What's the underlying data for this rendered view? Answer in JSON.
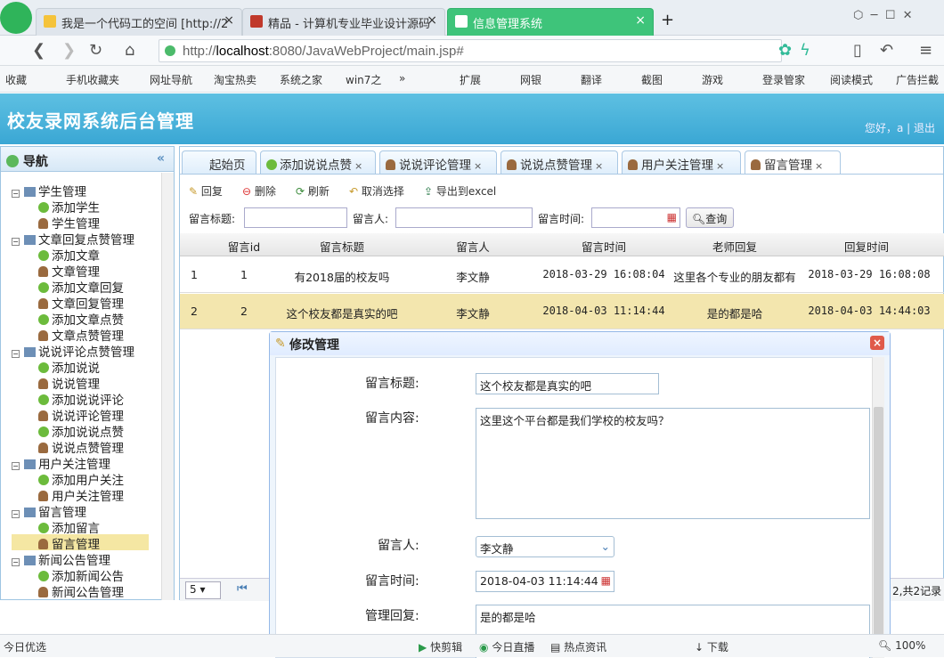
{
  "browser": {
    "tabs": [
      {
        "label": "我是一个代码工的空间 [http://2",
        "close": "×"
      },
      {
        "label": "精品 - 计算机专业毕业设计源码",
        "close": "×"
      },
      {
        "label": "信息管理系统",
        "close": "×"
      }
    ],
    "new_tab": "+",
    "url_prefix": "http://",
    "url_host": "localhost",
    "url_rest": ":8080/JavaWebProject/main.jsp#",
    "bookmarks": [
      "收藏",
      "手机收藏夹",
      "网址导航",
      "淘宝热卖",
      "系统之家",
      "win7之",
      "»",
      "扩展",
      "网银",
      "翻译",
      "截图",
      "游戏",
      "登录管家",
      "阅读模式",
      "广告拦截"
    ]
  },
  "app": {
    "title": "校友录网系统后台管理",
    "greeting": "您好，a",
    "logout": "退出"
  },
  "sidebar": {
    "title": "导航",
    "collapse": "«",
    "items": [
      {
        "label": "学生管理",
        "level": 0
      },
      {
        "label": "添加学生",
        "level": 1,
        "icon": "plus"
      },
      {
        "label": "学生管理",
        "level": 1,
        "icon": "user"
      },
      {
        "label": "文章回复点赞管理",
        "level": 0
      },
      {
        "label": "添加文章",
        "level": 1,
        "icon": "plus"
      },
      {
        "label": "文章管理",
        "level": 1,
        "icon": "user"
      },
      {
        "label": "添加文章回复",
        "level": 1,
        "icon": "plus"
      },
      {
        "label": "文章回复管理",
        "level": 1,
        "icon": "user"
      },
      {
        "label": "添加文章点赞",
        "level": 1,
        "icon": "plus"
      },
      {
        "label": "文章点赞管理",
        "level": 1,
        "icon": "user"
      },
      {
        "label": "说说评论点赞管理",
        "level": 0
      },
      {
        "label": "添加说说",
        "level": 1,
        "icon": "plus"
      },
      {
        "label": "说说管理",
        "level": 1,
        "icon": "user"
      },
      {
        "label": "添加说说评论",
        "level": 1,
        "icon": "plus"
      },
      {
        "label": "说说评论管理",
        "level": 1,
        "icon": "user"
      },
      {
        "label": "添加说说点赞",
        "level": 1,
        "icon": "plus"
      },
      {
        "label": "说说点赞管理",
        "level": 1,
        "icon": "user"
      },
      {
        "label": "用户关注管理",
        "level": 0
      },
      {
        "label": "添加用户关注",
        "level": 1,
        "icon": "plus"
      },
      {
        "label": "用户关注管理",
        "level": 1,
        "icon": "user"
      },
      {
        "label": "留言管理",
        "level": 0
      },
      {
        "label": "添加留言",
        "level": 1,
        "icon": "plus"
      },
      {
        "label": "留言管理",
        "level": 1,
        "icon": "user",
        "selected": true
      },
      {
        "label": "新闻公告管理",
        "level": 0
      },
      {
        "label": "添加新闻公告",
        "level": 1,
        "icon": "plus"
      },
      {
        "label": "新闻公告管理",
        "level": 1,
        "icon": "user"
      }
    ]
  },
  "page_tabs": [
    {
      "label": "起始页"
    },
    {
      "label": "添加说说点赞",
      "close": "×"
    },
    {
      "label": "说说评论管理",
      "close": "×"
    },
    {
      "label": "说说点赞管理",
      "close": "×"
    },
    {
      "label": "用户关注管理",
      "close": "×"
    },
    {
      "label": "留言管理",
      "close": "×",
      "active": true
    }
  ],
  "toolbar": {
    "reply": "回复",
    "delete": "删除",
    "refresh": "刷新",
    "cancel_select": "取消选择",
    "export": "导出到excel"
  },
  "search": {
    "title_label": "留言标题:",
    "person_label": "留言人:",
    "time_label": "留言时间:",
    "query": "查询"
  },
  "grid": {
    "columns": [
      "留言id",
      "留言标题",
      "留言人",
      "留言时间",
      "老师回复",
      "回复时间"
    ],
    "rows": [
      {
        "rownum": "1",
        "id": "1",
        "title": "有2018届的校友吗",
        "person": "李文静",
        "time": "2018-03-29 16:08:04",
        "reply": "这里各个专业的朋友都有",
        "reply_time": "2018-03-29 16:08:08"
      },
      {
        "rownum": "2",
        "id": "2",
        "title": "这个校友都是真实的吧",
        "person": "李文静",
        "time": "2018-04-03 11:14:44",
        "reply": "是的都是哈",
        "reply_time": "2018-04-03 14:44:03"
      }
    ]
  },
  "pager": {
    "page_size": "5",
    "summary": "2,共2记录"
  },
  "dialog": {
    "title": "修改管理",
    "close": "×",
    "fields": {
      "title_label": "留言标题:",
      "title_value": "这个校友都是真实的吧",
      "content_label": "留言内容:",
      "content_value": "这里这个平台都是我们学校的校友吗？",
      "person_label": "留言人:",
      "person_value": "李文静",
      "time_label": "留言时间:",
      "time_value": "2018-04-03 11:14:44",
      "reply_label": "管理回复:",
      "reply_value": "是的都是哈"
    }
  },
  "statusbar": {
    "left": "今日优选",
    "items": [
      "快剪辑",
      "今日直播",
      "热点资讯",
      "下载",
      "100%"
    ]
  },
  "colors": {
    "header": "#3aa7d4",
    "active_tab": "#3ec47a",
    "selection": "#f3e6ae"
  }
}
